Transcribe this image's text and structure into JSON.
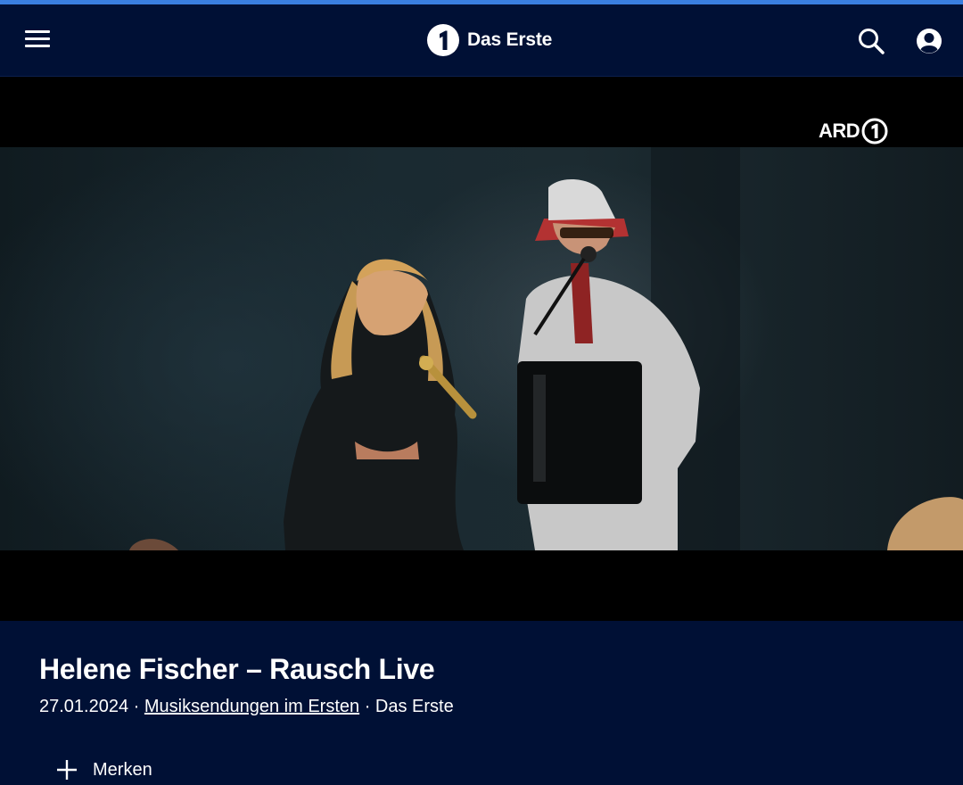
{
  "header": {
    "brand": "Das Erste",
    "menu_icon": "hamburger-menu-icon",
    "search_icon": "search-icon",
    "account_icon": "account-icon"
  },
  "player": {
    "channel_badge": "ARD"
  },
  "program": {
    "title": "Helene Fischer – Rausch Live",
    "date": "27.01.2024",
    "category": "Musiksendungen im Ersten",
    "channel": "Das Erste"
  },
  "actions": {
    "merken_label": "Merken"
  },
  "colors": {
    "background": "#001035",
    "accent": "#3a7fe0",
    "text": "#ffffff"
  }
}
